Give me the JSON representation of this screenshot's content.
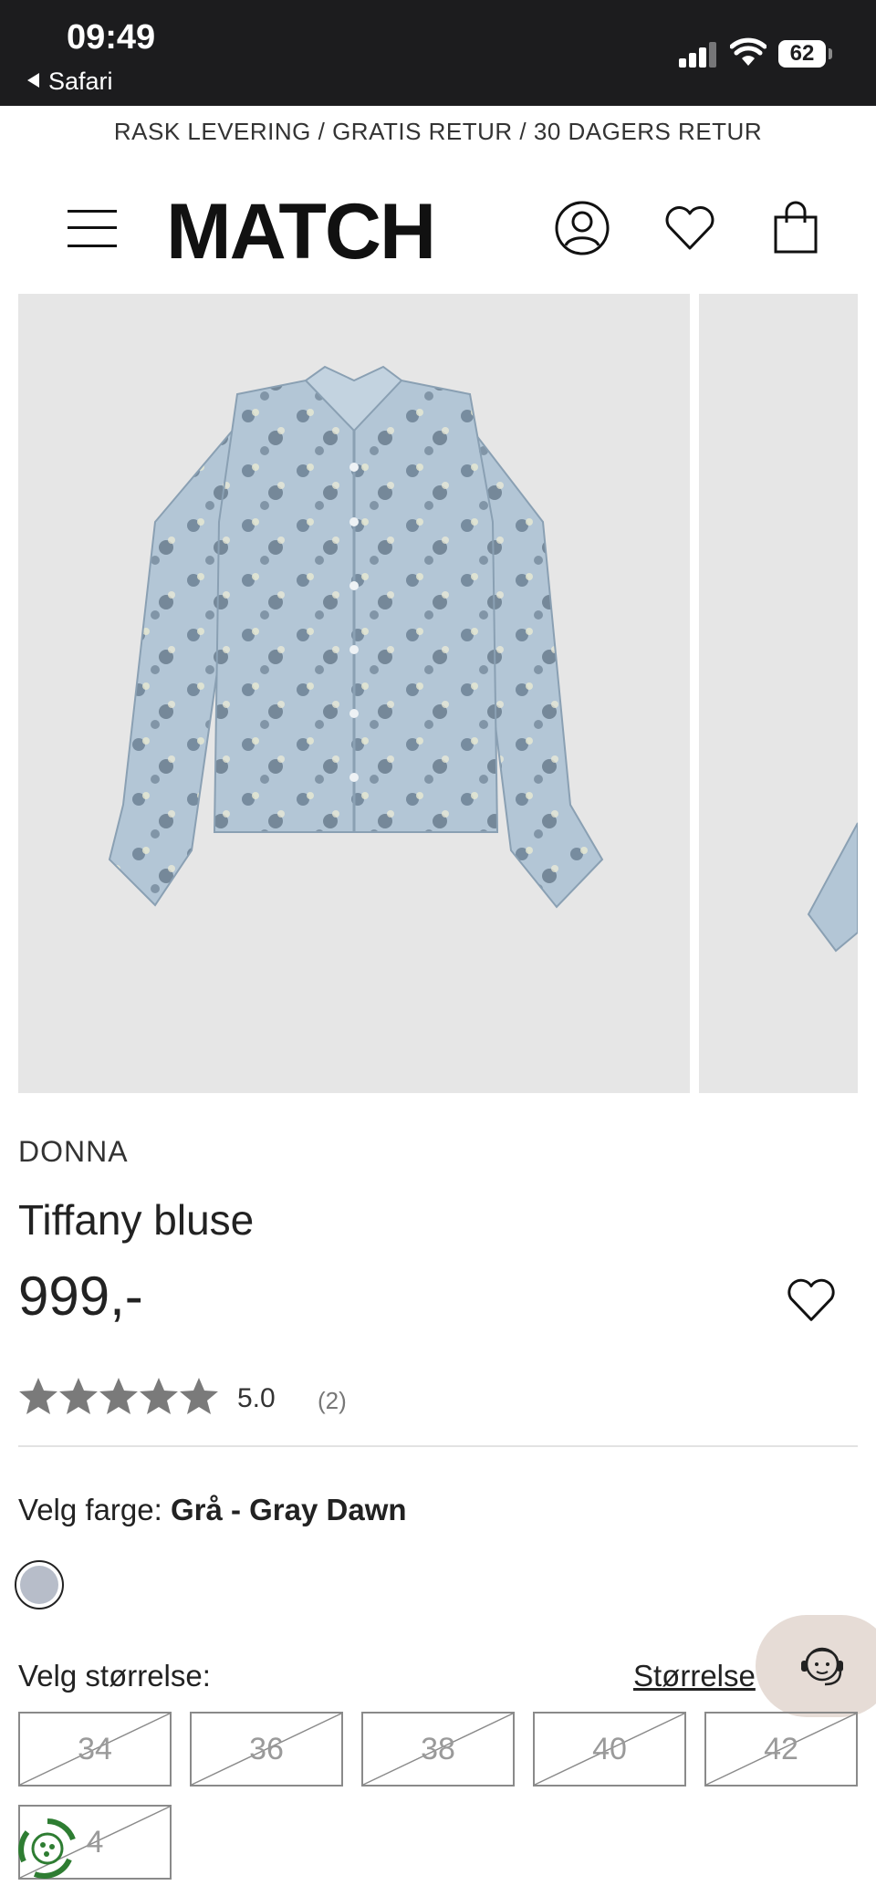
{
  "status_bar": {
    "time": "09:49",
    "back_app": "Safari",
    "battery": "62"
  },
  "promo": {
    "text": "RASK LEVERING / GRATIS RETUR / 30 DAGERS RETUR"
  },
  "header": {
    "logo": "MATCH"
  },
  "product": {
    "brand": "DONNA",
    "title": "Tiffany bluse",
    "price": "999,-",
    "rating": {
      "stars": 5,
      "score": "5.0",
      "count": "(2)"
    }
  },
  "color": {
    "label": "Velg farge: ",
    "value": "Grå - Gray Dawn",
    "swatch": "#b7bdc9"
  },
  "size": {
    "label": "Velg størrelse:",
    "guide_link": "Størrelse",
    "options": [
      "34",
      "36",
      "38",
      "40",
      "42",
      "4"
    ]
  },
  "colors": {
    "status_bg": "#1c1c1e",
    "image_bg": "#e6e6e6",
    "chat_bg": "#e6dcd6",
    "star": "#7a7a7a"
  }
}
